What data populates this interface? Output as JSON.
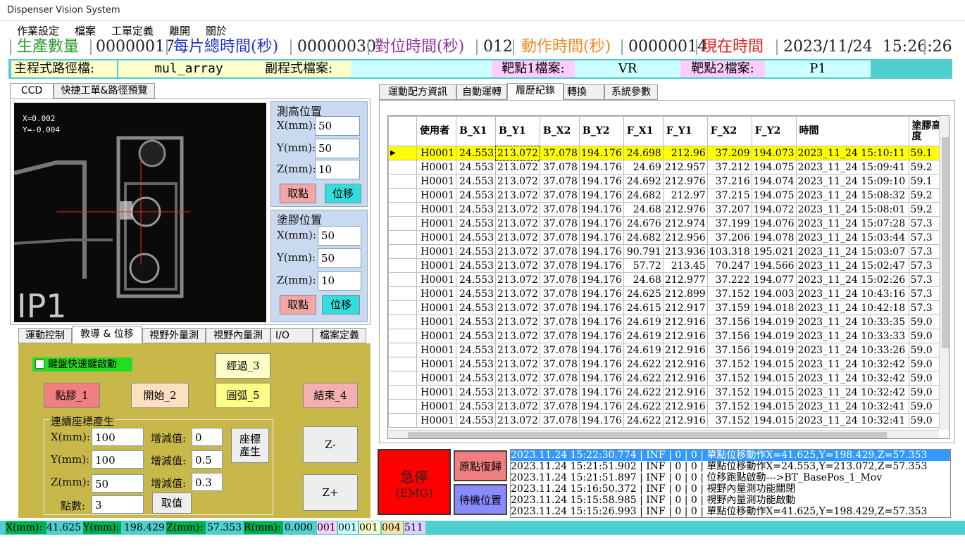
{
  "window": {
    "title": "Dispenser Vision System"
  },
  "menu": [
    "作業設定",
    "檔案",
    "工單定義",
    "離開",
    "關於"
  ],
  "stats": {
    "prod_label": "生產數量",
    "prod_value": "00000017",
    "total_label": "每片總時間(秒)",
    "total_value": "00000030",
    "align_label": "對位時間(秒)",
    "align_value": "012",
    "action_label": "動作時間(秒)",
    "action_value": "00000014",
    "now_label": "現在時間",
    "now_value": "2023/11/24  15:26:26"
  },
  "paths": {
    "main_label": "主程式路徑檔:",
    "main_value": "mul_array",
    "sub_label": "副程式檔案:",
    "sub_value": "",
    "t1_label": "靶點1檔案:",
    "t1_value": "VR",
    "t2_label": "靶點2檔案:",
    "t2_value": "P1"
  },
  "left_tabs": [
    "CCD",
    "快捷工單&路徑預覽"
  ],
  "ccd": {
    "x": "X=0.002",
    "y": "Y=-0.004",
    "overlay_text": "IP1"
  },
  "height_panel": {
    "title": "測高位置",
    "x_label": "X(mm):",
    "x_value": "50",
    "y_label": "Y(mm):",
    "y_value": "50",
    "z_label": "Z(mm):",
    "z_value": "10",
    "take_btn": "取點",
    "move_btn": "位移"
  },
  "glue_panel": {
    "title": "塗膠位置",
    "x_label": "X(mm):",
    "x_value": "50",
    "y_label": "Y(mm):",
    "y_value": "50",
    "z_label": "Z(mm):",
    "z_value": "10",
    "take_btn": "取點",
    "move_btn": "位移"
  },
  "bottom_tabs": [
    "運動控制",
    "教導 & 位移",
    "視野外量測",
    "視野內量測",
    "I/O",
    "檔案定義"
  ],
  "teach": {
    "kbd_label": "鍵盤快速鍵啟動",
    "btn_pass": "經過_3",
    "btn_dot": "點膠_1",
    "btn_start": "開始_2",
    "btn_arc": "圓弧_5",
    "btn_end": "結束_4",
    "coord_title": "連續座標產生",
    "x_label": "X(mm):",
    "x_value": "100",
    "y_label": "Y(mm):",
    "y_value": "100",
    "z_label": "Z(mm):",
    "z_value": "50",
    "count_label": "點數:",
    "count_value": "3",
    "inc_label": "增減值:",
    "inc_x": "0",
    "inc_y": "0.5",
    "inc_z": "0.3",
    "gen_btn": "座標\n產生",
    "take_btn": "取值",
    "zminus": "Z-",
    "zplus": "Z+"
  },
  "right_tabs": [
    "運動配方資訊",
    "自動運轉",
    "履歷紀錄",
    "轉換",
    "系統參數"
  ],
  "table": {
    "headers": [
      "使用者",
      "B_X1",
      "B_Y1",
      "B_X2",
      "B_Y2",
      "F_X1",
      "F_Y1",
      "F_X2",
      "F_Y2",
      "時間",
      "塗膠高度"
    ],
    "rows": [
      [
        "H0001",
        "24.553",
        "213.072",
        "37.078",
        "194.176",
        "24.698",
        "212.96",
        "37.209",
        "194.073",
        "2023_11_24  15:10:11",
        "59.1"
      ],
      [
        "H0001",
        "24.553",
        "213.072",
        "37.078",
        "194.176",
        "24.69",
        "212.957",
        "37.212",
        "194.075",
        "2023_11_24  15:09:41",
        "59.2"
      ],
      [
        "H0001",
        "24.553",
        "213.072",
        "37.078",
        "194.176",
        "24.692",
        "212.976",
        "37.216",
        "194.074",
        "2023_11_24  15:09:10",
        "59.1"
      ],
      [
        "H0001",
        "24.553",
        "213.072",
        "37.078",
        "194.176",
        "24.682",
        "212.97",
        "37.215",
        "194.075",
        "2023_11_24  15:08:32",
        "59.2"
      ],
      [
        "H0001",
        "24.553",
        "213.072",
        "37.078",
        "194.176",
        "24.68",
        "212.976",
        "37.207",
        "194.072",
        "2023_11_24  15:08:01",
        "59.2"
      ],
      [
        "H0001",
        "24.553",
        "213.072",
        "37.078",
        "194.176",
        "24.676",
        "212.974",
        "37.199",
        "194.076",
        "2023_11_24  15:07:28",
        "57.3"
      ],
      [
        "H0001",
        "24.553",
        "213.072",
        "37.078",
        "194.176",
        "24.682",
        "212.956",
        "37.206",
        "194.078",
        "2023_11_24  15:03:44",
        "57.3"
      ],
      [
        "H0001",
        "24.553",
        "213.072",
        "37.078",
        "194.176",
        "90.791",
        "213.936",
        "103.318",
        "195.021",
        "2023_11_24  15:03:07",
        "57.3"
      ],
      [
        "H0001",
        "24.553",
        "213.072",
        "37.078",
        "194.176",
        "57.72",
        "213.45",
        "70.247",
        "194.566",
        "2023_11_24  15:02:47",
        "57.3"
      ],
      [
        "H0001",
        "24.553",
        "213.072",
        "37.078",
        "194.176",
        "24.68",
        "212.977",
        "37.222",
        "194.077",
        "2023_11_24  15:02:26",
        "57.3"
      ],
      [
        "H0001",
        "24.553",
        "213.072",
        "37.078",
        "194.176",
        "24.625",
        "212.899",
        "37.152",
        "194.003",
        "2023_11_24  10:43:16",
        "57.3"
      ],
      [
        "H0001",
        "24.553",
        "213.072",
        "37.078",
        "194.176",
        "24.615",
        "212.917",
        "37.159",
        "194.018",
        "2023_11_24  10:42:18",
        "57.3"
      ],
      [
        "H0001",
        "24.553",
        "213.072",
        "37.078",
        "194.176",
        "24.619",
        "212.916",
        "37.156",
        "194.019",
        "2023_11_24  10:33:35",
        "59.0"
      ],
      [
        "H0001",
        "24.553",
        "213.072",
        "37.078",
        "194.176",
        "24.619",
        "212.916",
        "37.156",
        "194.019",
        "2023_11_24  10:33:33",
        "59.0"
      ],
      [
        "H0001",
        "24.553",
        "213.072",
        "37.078",
        "194.176",
        "24.619",
        "212.916",
        "37.156",
        "194.019",
        "2023_11_24  10:33:26",
        "59.0"
      ],
      [
        "H0001",
        "24.553",
        "213.072",
        "37.078",
        "194.176",
        "24.622",
        "212.916",
        "37.152",
        "194.015",
        "2023_11_24  10:32:42",
        "59.0"
      ],
      [
        "H0001",
        "24.553",
        "213.072",
        "37.078",
        "194.176",
        "24.622",
        "212.916",
        "37.152",
        "194.015",
        "2023_11_24  10:32:42",
        "59.0"
      ],
      [
        "H0001",
        "24.553",
        "213.072",
        "37.078",
        "194.176",
        "24.622",
        "212.916",
        "37.152",
        "194.015",
        "2023_11_24  10:32:42",
        "59.0"
      ],
      [
        "H0001",
        "24.553",
        "213.072",
        "37.078",
        "194.176",
        "24.622",
        "212.916",
        "37.152",
        "194.015",
        "2023_11_24  10:32:41",
        "59.0"
      ],
      [
        "H0001",
        "24.553",
        "213.072",
        "37.078",
        "194.176",
        "24.622",
        "212.916",
        "37.152",
        "194.015",
        "2023_11_24  10:32:41",
        "59.0"
      ]
    ]
  },
  "emg": {
    "label": "急停",
    "sub": "(EMG)",
    "home_btn": "原點復歸",
    "standby_btn": "待機位置"
  },
  "log": [
    "2023.11.24 15:22:30.774 | INF | 0 | 0 | 單點位移動作X=41.625,Y=198.429,Z=57.353",
    "2023.11.24 15:21:51.902 | INF | 0 | 0 | 單點位移動作X=24.553,Y=213.072,Z=57.353",
    "2023.11.24 15:21:51.897 | INF | 0 | 0 | 位移跑點啟動--->BT_BasePos_1_Mov",
    "2023.11.24 15:16:50.372 | INF | 0 | 0 | 視野內量測功能關閉",
    "2023.11.24 15:15:58.985 | INF | 0 | 0 | 視野內量測功能啟動",
    "2023.11.24 15:15:26.993 | INF | 0 | 0 | 單點位移動作X=41.625,Y=198.429,Z=57.353"
  ],
  "status": {
    "x_label": "X(mm):",
    "x_value": "41.625",
    "y_label": "Y(mm):",
    "y_value": "198.429",
    "z_label": "Z(mm):",
    "z_value": "57.353",
    "r_label": "R(mm):",
    "r_value": "0.000",
    "c1": "001",
    "c2": "001",
    "c3": "001",
    "c4": "004",
    "c5": "511"
  },
  "colors": {
    "accent_cyan": "#4fcfcf",
    "panel_blue": "#c9daf0",
    "panel_olive": "#c8b84a",
    "emg_red": "#ff0000",
    "selected_row": "#ffff00",
    "status_green": "#00b050"
  }
}
